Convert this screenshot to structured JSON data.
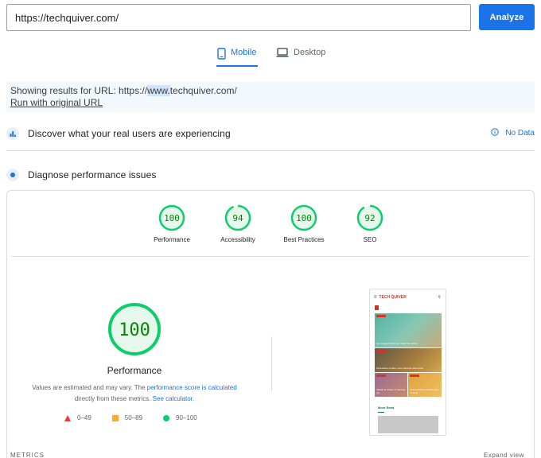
{
  "search": {
    "url_value": "https://techquiver.com/",
    "analyze_label": "Analyze"
  },
  "tabs": [
    {
      "label": "Mobile",
      "active": true
    },
    {
      "label": "Desktop",
      "active": false
    }
  ],
  "results": {
    "prefix": "Showing results for URL: https://",
    "highlight": "www.",
    "suffix": "techquiver.com/",
    "original_link": "Run with original URL"
  },
  "field_data": {
    "title": "Discover what your real users are experiencing",
    "status": "No Data"
  },
  "diagnose": {
    "title": "Diagnose performance issues"
  },
  "scores": [
    {
      "label": "Performance",
      "value": 100
    },
    {
      "label": "Accessibility",
      "value": 94
    },
    {
      "label": "Best Practices",
      "value": 100
    },
    {
      "label": "SEO",
      "value": 92
    }
  ],
  "main_score": {
    "value": "100",
    "label": "Performance",
    "desc_part1": "Values are estimated and may vary. The ",
    "desc_link1": "performance score is calculated",
    "desc_part2": "directly from these metrics. ",
    "desc_link2": "See calculator."
  },
  "legend": [
    {
      "shape": "triangle",
      "range": "0–49",
      "color": "#ff3333"
    },
    {
      "shape": "square",
      "range": "50–89",
      "color": "#ffaa33"
    },
    {
      "shape": "circle",
      "range": "90–100",
      "color": "#0cce6b"
    }
  ],
  "preview": {
    "site_name": "TECH QUIVER",
    "card1_caption": "Our creators were not make the variety",
    "card2_caption": "Persuasive is often more effective than force",
    "card3_caption": "Splash is ranger of relaxing out",
    "card4_caption": "Villa and Rose Visiting Sea on Boat",
    "most_read": "Most Read"
  },
  "footer": {
    "metrics": "METRICS",
    "expand": "Expand view"
  },
  "colors": {
    "accent": "#1a73e8",
    "pass": "#0cce6b",
    "pass_text": "#008800"
  }
}
